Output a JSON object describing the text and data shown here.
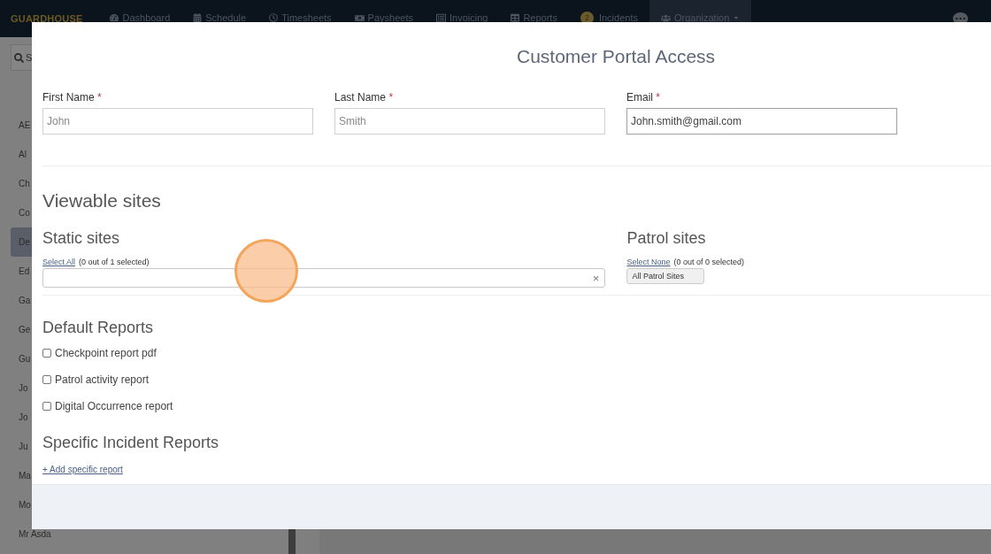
{
  "navbar": {
    "brand": "GUARDHOUSE",
    "items": [
      {
        "label": "Dashboard",
        "selected": false
      },
      {
        "label": "Schedule",
        "selected": false
      },
      {
        "label": "Timesheets",
        "selected": false
      },
      {
        "label": "Paysheets",
        "selected": false
      },
      {
        "label": "Invoicing",
        "selected": false
      },
      {
        "label": "Reports",
        "selected": false
      },
      {
        "label": "Incidents",
        "badge": "2",
        "selected": false
      },
      {
        "label": "Organization",
        "dropdown": true,
        "selected": true
      }
    ]
  },
  "sidebar": {
    "search": {
      "placeholder": "S"
    },
    "items": [
      {
        "label": "AE",
        "selected": false
      },
      {
        "label": "Al",
        "selected": false
      },
      {
        "label": "Ch",
        "selected": false
      },
      {
        "label": "Co",
        "selected": false
      },
      {
        "label": "De",
        "selected": true
      },
      {
        "label": "Ed",
        "selected": false
      },
      {
        "label": "Ga",
        "selected": false
      },
      {
        "label": "Ge",
        "selected": false
      },
      {
        "label": "Gu",
        "selected": false
      },
      {
        "label": "Jo",
        "selected": false
      },
      {
        "label": "Jo",
        "selected": false
      },
      {
        "label": "Ju",
        "selected": false
      },
      {
        "label": "Ma",
        "selected": false
      },
      {
        "label": "Mo",
        "selected": false
      },
      {
        "label": "Mr Asda",
        "selected": false
      }
    ]
  },
  "modal": {
    "title": "Customer Portal Access",
    "fields": [
      {
        "label": "First Name",
        "required": "*",
        "placeholder": "John",
        "active": false
      },
      {
        "label": "Last Name",
        "required": "*",
        "placeholder": "Smith",
        "active": false
      },
      {
        "label": "Email",
        "required": "*",
        "value": "John.smith@gmail.com",
        "active": true
      }
    ],
    "viewable_title": "Viewable sites",
    "static_sites": {
      "title": "Static sites",
      "link": "Select All",
      "count": "(0 out of 1 selected)",
      "clear": "×"
    },
    "patrol_sites": {
      "title": "Patrol sites",
      "link": "Select None",
      "count": "(0 out of 0 selected)",
      "tags": [
        "All Patrol Sites"
      ]
    },
    "default_reports": {
      "title": "Default Reports",
      "items": [
        {
          "label": "Checkpoint report pdf",
          "checked": false
        },
        {
          "label": "Patrol activity report",
          "checked": false
        },
        {
          "label": "Digital Occurrence report",
          "checked": false
        }
      ]
    },
    "specific_reports": {
      "title": "Specific Incident Reports",
      "link": "+ Add specific report"
    }
  }
}
